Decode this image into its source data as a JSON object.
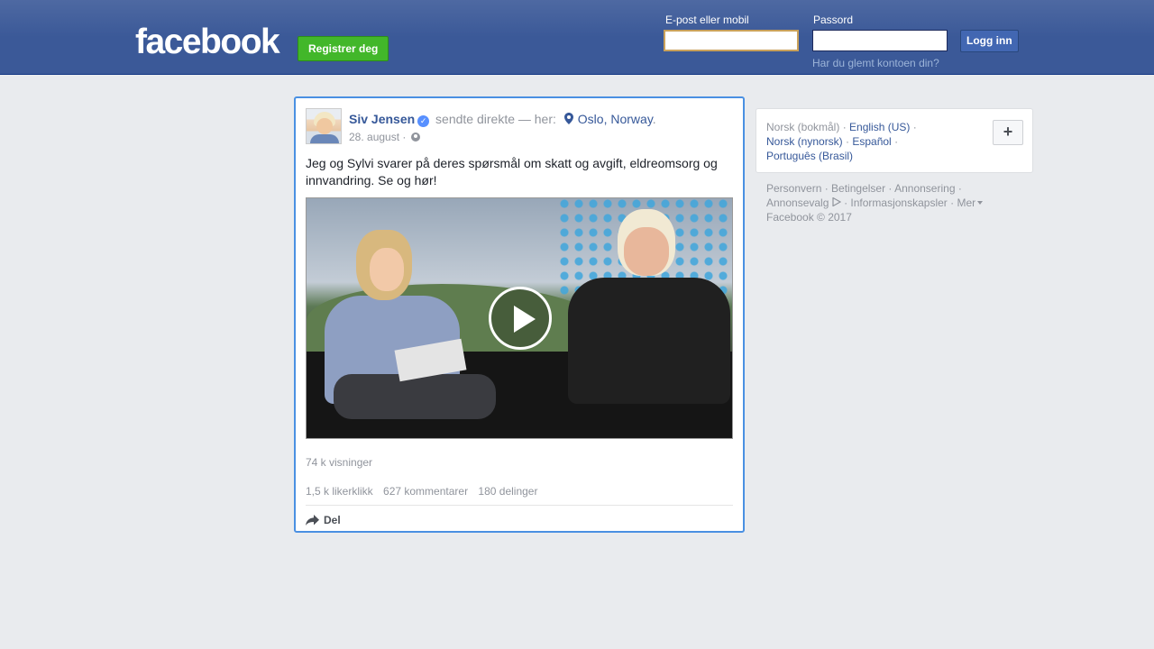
{
  "header": {
    "logo": "facebook",
    "register_label": "Registrer deg",
    "email_label": "E-post eller mobil",
    "email_value": "",
    "password_label": "Passord",
    "password_value": "",
    "login_label": "Logg inn",
    "forgot_label": "Har du glemt kontoen din?"
  },
  "post": {
    "author": "Siv Jensen",
    "action": "sendte direkte — her:",
    "location": "Oslo, Norway",
    "date": "28. august ·",
    "text": "Jeg og Sylvi svarer på deres spørsmål om skatt og avgift, eldreomsorg og innvandring. Se og hør!",
    "views": "74 k visninger",
    "likes": "1,5 k likerklikk",
    "comments": "627 kommentarer",
    "shares": "180 delinger",
    "share_label": "Del"
  },
  "languages": {
    "current": "Norsk (bokmål)",
    "options": [
      "English (US)",
      "Norsk (nynorsk)",
      "Español",
      "Português (Brasil)"
    ],
    "add_label": "+"
  },
  "footer": {
    "links": [
      "Personvern",
      "Betingelser",
      "Annonsering",
      "Annonsevalg",
      "Informasjonskapsler",
      "Mer"
    ],
    "copyright": "Facebook © 2017"
  },
  "colors": {
    "brand": "#3b5998",
    "link": "#365899",
    "register_green": "#42b72a",
    "post_border": "#4a90e2"
  }
}
